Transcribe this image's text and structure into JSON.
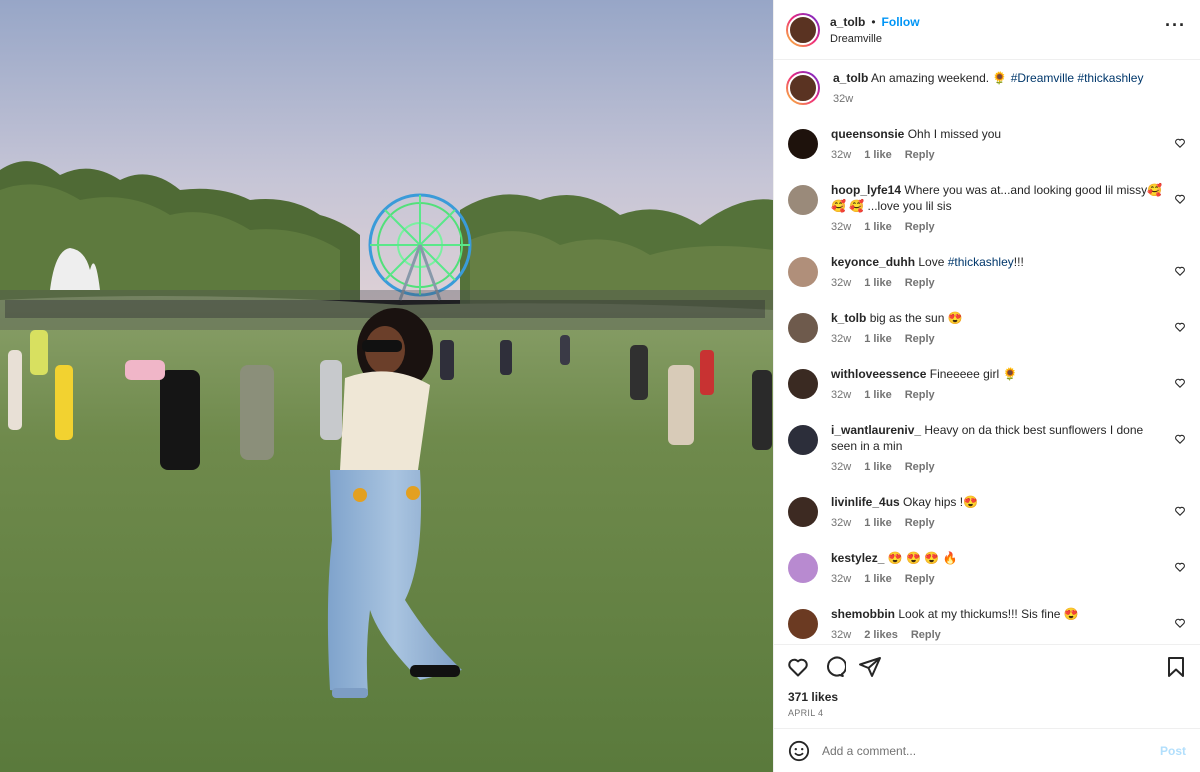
{
  "post": {
    "username": "a_tolb",
    "follow_label": "Follow",
    "location": "Dreamville",
    "more_icon": "more-icon"
  },
  "caption": {
    "username": "a_tolb",
    "text_before": "An amazing weekend. ",
    "emoji": "🌻",
    "hashtag1": "#Dreamville",
    "hashtag2": "#thickashley",
    "time": "32w"
  },
  "comments": [
    {
      "user": "queensonsie",
      "text": "Ohh I missed you",
      "time": "32w",
      "likes": "1 like",
      "reply": "Reply",
      "color": "#1e120c"
    },
    {
      "user": "hoop_lyfe14",
      "text": "Where you was at...and looking good lil missy🥰🥰 🥰 ...love you lil sis",
      "time": "32w",
      "likes": "1 like",
      "reply": "Reply",
      "color": "#9a8a7a"
    },
    {
      "user": "keyonce_duhh",
      "text_before": "Love ",
      "tag": "#thickashley",
      "text_after": "!!!",
      "time": "32w",
      "likes": "1 like",
      "reply": "Reply",
      "color": "#b08f7a"
    },
    {
      "user": "k_tolb",
      "text": "big as the sun 😍",
      "time": "32w",
      "likes": "1 like",
      "reply": "Reply",
      "color": "#6e5a4c"
    },
    {
      "user": "withloveessence",
      "text": "Fineeeee girl 🌻",
      "time": "32w",
      "likes": "1 like",
      "reply": "Reply",
      "color": "#3a2a22"
    },
    {
      "user": "i_wantlaureniv_",
      "text": "Heavy on da thick best sunflowers I done seen in a min",
      "time": "32w",
      "likes": "1 like",
      "reply": "Reply",
      "color": "#2c2e3a"
    },
    {
      "user": "livinlife_4us",
      "text": "Okay hips !😍",
      "time": "32w",
      "likes": "1 like",
      "reply": "Reply",
      "color": "#3d2a22"
    },
    {
      "user": "kestylez_",
      "text": "😍 😍 😍 🔥",
      "time": "32w",
      "likes": "1 like",
      "reply": "Reply",
      "color": "#b88ad0"
    },
    {
      "user": "shemobbin",
      "text": "Look at my thickums!!! Sis fine 😍",
      "time": "32w",
      "likes": "2 likes",
      "reply": "Reply",
      "color": "#6b3a22"
    }
  ],
  "actions": {
    "like_icon": "heart-icon",
    "comment_icon": "comment-icon",
    "share_icon": "share-icon",
    "save_icon": "bookmark-icon"
  },
  "likes_count": "371 likes",
  "date": "APRIL 4",
  "add_comment": {
    "placeholder": "Add a comment...",
    "post_label": "Post",
    "emoji_icon": "smiley-icon"
  }
}
